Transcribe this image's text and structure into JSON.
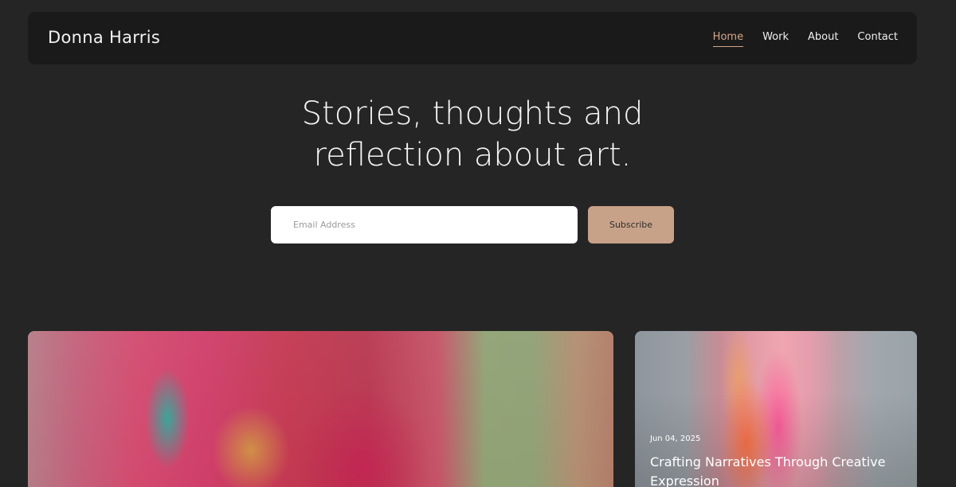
{
  "header": {
    "brand": "Donna Harris",
    "nav": [
      {
        "label": "Home",
        "active": true
      },
      {
        "label": "Work",
        "active": false
      },
      {
        "label": "About",
        "active": false
      },
      {
        "label": "Contact",
        "active": false
      }
    ]
  },
  "hero": {
    "title": "Stories, thoughts and\nreflection about art."
  },
  "subscribe": {
    "email_placeholder": "Email Address",
    "button_label": "Subscribe"
  },
  "posts": [
    {
      "date": "",
      "title": ""
    },
    {
      "date": "Jun 04, 2025",
      "title": "Crafting Narratives Through Creative Expression"
    }
  ],
  "colors": {
    "background": "#252525",
    "header_bg": "#1a1a1a",
    "accent": "#d6a58a",
    "button_bg": "#c8a288"
  }
}
